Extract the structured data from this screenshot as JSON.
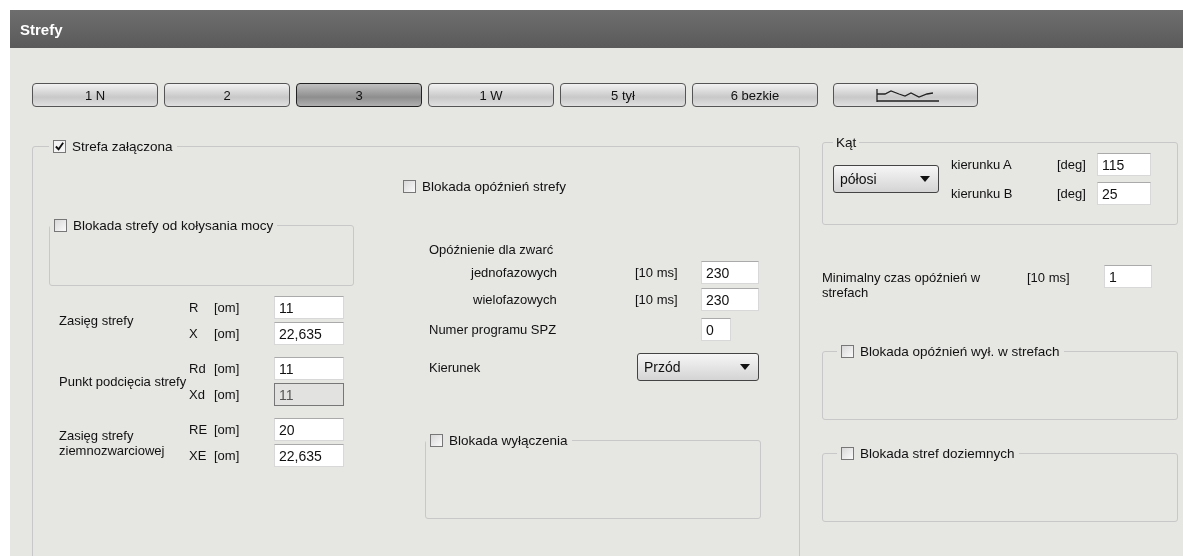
{
  "window": {
    "title": "Strefy"
  },
  "tabs": [
    {
      "kind": "text",
      "label": "1 N",
      "selected": false
    },
    {
      "kind": "text",
      "label": "2",
      "selected": false
    },
    {
      "kind": "text",
      "label": "3",
      "selected": true
    },
    {
      "kind": "text",
      "label": "1 W",
      "selected": false
    },
    {
      "kind": "text",
      "label": "5 tył",
      "selected": false
    },
    {
      "kind": "text",
      "label": "6 bezkie",
      "selected": false
    },
    {
      "kind": "icon",
      "selected": false
    }
  ],
  "zone": {
    "label": "Strefa załączona",
    "checked": true,
    "swing_block": {
      "label": "Blokada strefy od kołysania mocy",
      "checked": false
    },
    "reach_rows": [
      {
        "label": "Zasięg strefy",
        "fields": [
          {
            "symbol": "R",
            "unit": "[om]",
            "value": "11",
            "disabled": false
          },
          {
            "symbol": "X",
            "unit": "[om]",
            "value": "22,635",
            "disabled": false
          }
        ]
      },
      {
        "label": "Punkt podcięcia strefy",
        "fields": [
          {
            "symbol": "Rd",
            "unit": "[om]",
            "value": "11",
            "disabled": false
          },
          {
            "symbol": "Xd",
            "unit": "[om]",
            "value": "11",
            "disabled": true
          }
        ]
      },
      {
        "label": "Zasięg strefy ziemnozwarciowej",
        "fields": [
          {
            "symbol": "RE",
            "unit": "[om]",
            "value": "20",
            "disabled": false
          },
          {
            "symbol": "XE",
            "unit": "[om]",
            "value": "22,635",
            "disabled": false
          }
        ]
      }
    ],
    "delay_block": {
      "label": "Blokada opóźnień strefy",
      "checked": false
    },
    "delay_heading": "Opóźnienie dla zwarć",
    "delays": [
      {
        "label": "jednofazowych",
        "unit": "[10 ms]",
        "value": "230"
      },
      {
        "label": "wielofazowych",
        "unit": "[10 ms]",
        "value": "230"
      }
    ],
    "spz": {
      "label": "Numer programu SPZ",
      "value": "0"
    },
    "direction": {
      "label": "Kierunek",
      "value": "Przód"
    },
    "trip_block": {
      "label": "Blokada wyłączenia",
      "checked": false
    }
  },
  "angle": {
    "title": "Kąt",
    "mode": "półosi",
    "rows": [
      {
        "label": "kierunku A",
        "unit": "[deg]",
        "value": "115"
      },
      {
        "label": "kierunku B",
        "unit": "[deg]",
        "value": "25"
      }
    ]
  },
  "min_delay": {
    "label": "Minimalny czas opóźnień w strefach",
    "unit": "[10 ms]",
    "value": "1"
  },
  "groups": [
    {
      "label": "Blokada opóźnień wył. w strefach",
      "checked": false
    },
    {
      "label": "Blokada stref doziemnych",
      "checked": false
    }
  ]
}
